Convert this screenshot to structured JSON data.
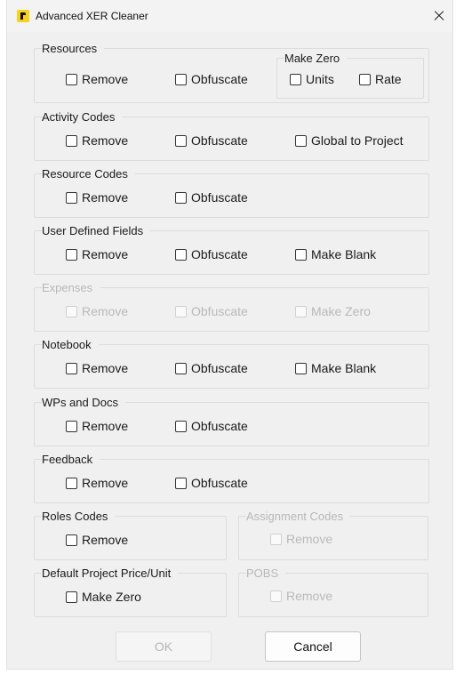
{
  "window": {
    "title": "Advanced XER Cleaner"
  },
  "groups": {
    "resources": {
      "title": "Resources",
      "remove": "Remove",
      "obfuscate": "Obfuscate",
      "make_zero": {
        "title": "Make Zero",
        "units": "Units",
        "rate": "Rate"
      }
    },
    "activity_codes": {
      "title": "Activity Codes",
      "remove": "Remove",
      "obfuscate": "Obfuscate",
      "global": "Global to Project"
    },
    "resource_codes": {
      "title": "Resource Codes",
      "remove": "Remove",
      "obfuscate": "Obfuscate"
    },
    "udf": {
      "title": "User Defined Fields",
      "remove": "Remove",
      "obfuscate": "Obfuscate",
      "make_blank": "Make Blank"
    },
    "expenses": {
      "title": "Expenses",
      "remove": "Remove",
      "obfuscate": "Obfuscate",
      "make_zero": "Make Zero"
    },
    "notebook": {
      "title": "Notebook",
      "remove": "Remove",
      "obfuscate": "Obfuscate",
      "make_blank": "Make Blank"
    },
    "wps_docs": {
      "title": "WPs and Docs",
      "remove": "Remove",
      "obfuscate": "Obfuscate"
    },
    "feedback": {
      "title": "Feedback",
      "remove": "Remove",
      "obfuscate": "Obfuscate"
    },
    "roles_codes": {
      "title": "Roles Codes",
      "remove": "Remove"
    },
    "assignment_codes": {
      "title": "Assignment Codes",
      "remove": "Remove"
    },
    "default_price": {
      "title": "Default Project Price/Unit",
      "make_zero": "Make Zero"
    },
    "pobs": {
      "title": "POBS",
      "remove": "Remove"
    }
  },
  "buttons": {
    "ok": "OK",
    "cancel": "Cancel"
  }
}
